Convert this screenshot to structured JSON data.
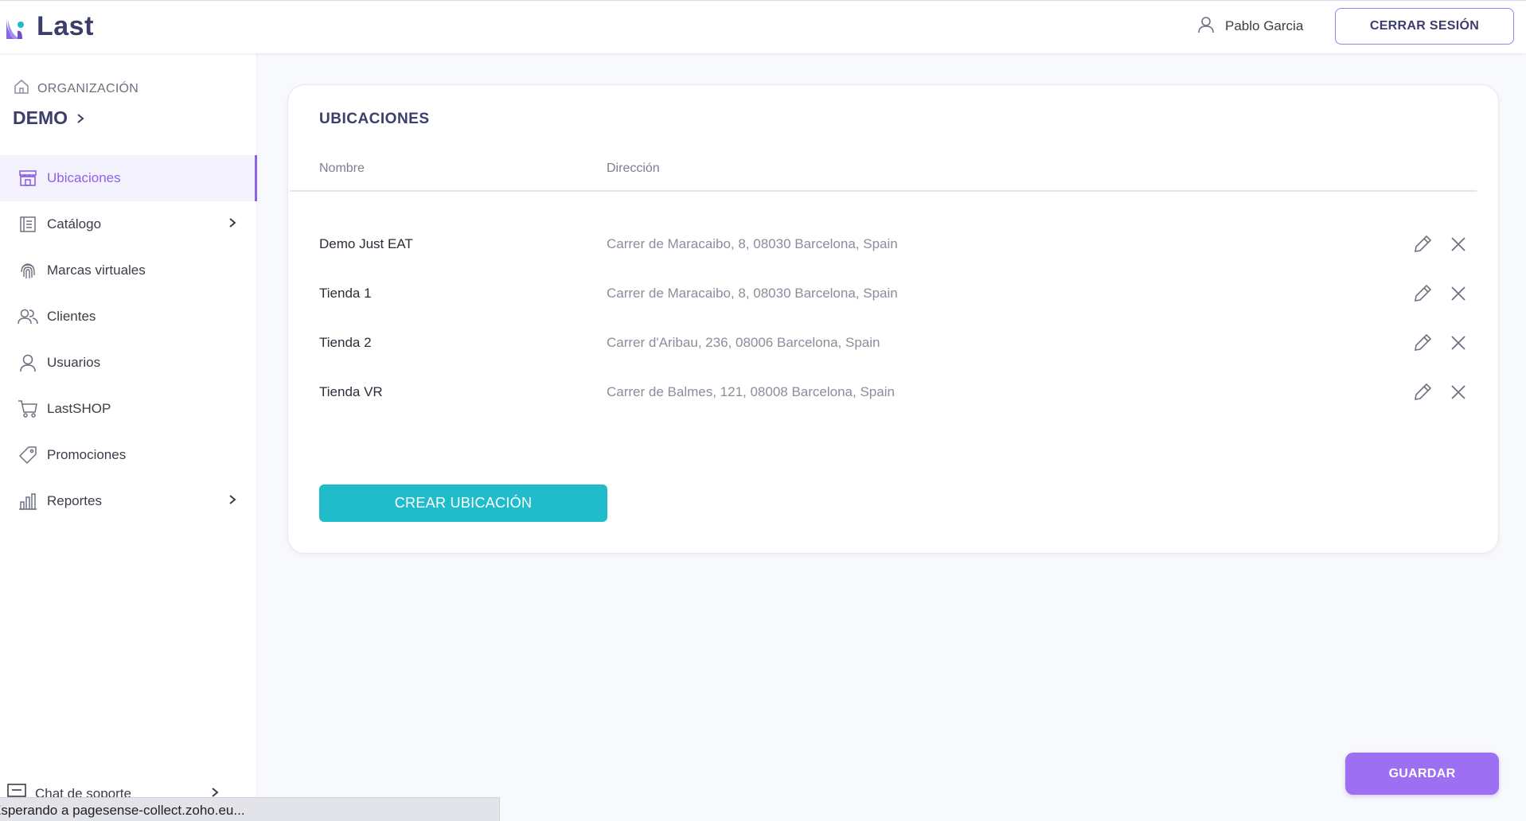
{
  "app": {
    "logo_text": "Last",
    "colors": {
      "accent": "#8c63e8",
      "create_button": "#21bccb",
      "save_button": "#9d6ff2",
      "brand_text": "#3b3e6a"
    }
  },
  "header": {
    "user_name": "Pablo Garcia",
    "user_icon": "user-icon",
    "logout_label": "CERRAR SESIÓN"
  },
  "sidebar": {
    "org_label": "ORGANIZACIÓN",
    "org_name": "DEMO",
    "items": [
      {
        "label": "Ubicaciones",
        "icon": "store-icon",
        "active": true,
        "has_submenu": false
      },
      {
        "label": "Catálogo",
        "icon": "catalog-icon",
        "active": false,
        "has_submenu": true
      },
      {
        "label": "Marcas virtuales",
        "icon": "fingerprint-icon",
        "active": false,
        "has_submenu": false
      },
      {
        "label": "Clientes",
        "icon": "users-icon",
        "active": false,
        "has_submenu": false
      },
      {
        "label": "Usuarios",
        "icon": "user-icon",
        "active": false,
        "has_submenu": false
      },
      {
        "label": "LastSHOP",
        "icon": "cart-icon",
        "active": false,
        "has_submenu": false
      },
      {
        "label": "Promociones",
        "icon": "tag-icon",
        "active": false,
        "has_submenu": false
      },
      {
        "label": "Reportes",
        "icon": "bar-chart-icon",
        "active": false,
        "has_submenu": true
      }
    ],
    "support_label": "Chat de soporte"
  },
  "locations": {
    "title": "UBICACIONES",
    "columns": [
      "Nombre",
      "Dirección"
    ],
    "rows": [
      {
        "name": "Demo Just EAT",
        "address": "Carrer de Maracaibo, 8, 08030 Barcelona, Spain"
      },
      {
        "name": "Tienda 1",
        "address": "Carrer de Maracaibo, 8, 08030 Barcelona, Spain"
      },
      {
        "name": "Tienda 2",
        "address": "Carrer d'Aribau, 236, 08006 Barcelona, Spain"
      },
      {
        "name": "Tienda VR",
        "address": "Carrer de Balmes, 121, 08008 Barcelona, Spain"
      }
    ],
    "create_label": "CREAR UBICACIÓN"
  },
  "save_label": "GUARDAR",
  "status_bar": "Esperando a pagesense-collect.zoho.eu..."
}
